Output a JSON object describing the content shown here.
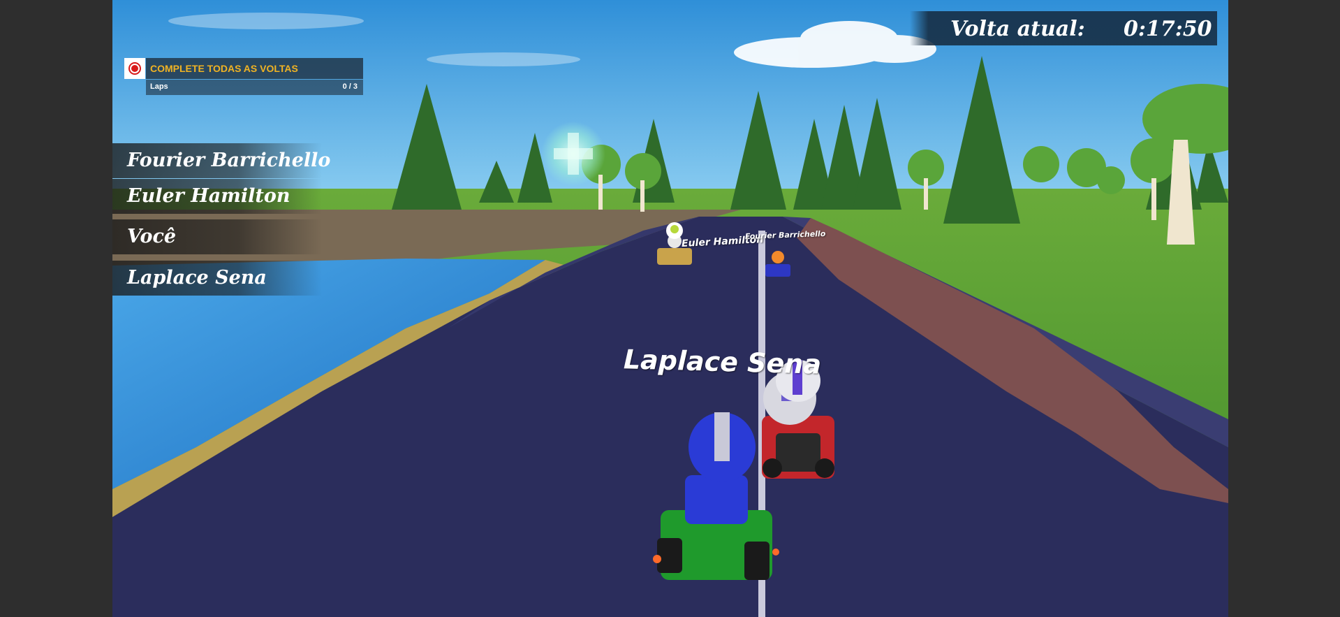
{
  "hud": {
    "lap_timer": {
      "label": "Volta atual:",
      "time": "0:17:50"
    },
    "objective": {
      "icon": "target-icon",
      "title": "COMPLETE TODAS AS VOLTAS",
      "laps_label": "Laps",
      "laps_value": "0 / 3"
    },
    "standings": [
      {
        "position": 1,
        "name": "Fourier Barrichello"
      },
      {
        "position": 2,
        "name": "Euler Hamilton"
      },
      {
        "position": 3,
        "name": "Você"
      },
      {
        "position": 4,
        "name": "Laplace Sena"
      }
    ]
  },
  "karts": {
    "near_tag": "Laplace Sena",
    "mid_tag": "Euler Hamilton",
    "far_tag": "Fourier Barrichello"
  },
  "colors": {
    "sky_top": "#3fa3e0",
    "road": "#2b2d5c",
    "grass": "#4f9a2e",
    "water": "#2f86d6",
    "objective_title": "#f0b323",
    "objective_icon": "#d91a1a",
    "player_kart": "#1f9a2c",
    "player_helmet": "#2a3bd6"
  }
}
